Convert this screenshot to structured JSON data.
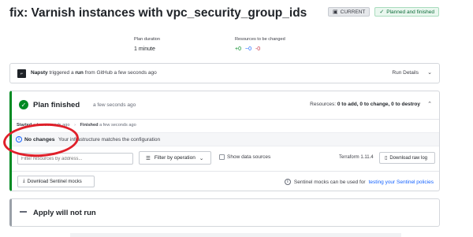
{
  "header": {
    "title": "fix: Varnish instances with vpc_security_group_ids",
    "badge_current": "CURRENT",
    "badge_status": "Planned and finished"
  },
  "meta": {
    "duration_label": "Plan duration",
    "duration_value": "1 minute",
    "resources_label": "Resources to be changed",
    "add": "+0",
    "change": "~0",
    "destroy": "-0"
  },
  "run": {
    "user": "Napsty",
    "triggered_text": "triggered a",
    "run_word": "run",
    "from_text": "from GitHub a few seconds ago",
    "details_label": "Run Details"
  },
  "plan": {
    "title": "Plan finished",
    "time": "a few seconds ago",
    "summary_prefix": "Resources:",
    "summary_add": "0 to add,",
    "summary_change": "0 to change,",
    "summary_destroy": "0 to destroy",
    "started_label": "Started",
    "started_time": "a few seconds ago",
    "finished_label": "Finished",
    "finished_time": "a few seconds ago",
    "no_changes_title": "No changes",
    "no_changes_msg": "Your infrastructure matches the configuration",
    "filter_placeholder": "Filter resources by address...",
    "filter_op_label": "Filter by operation",
    "show_ds_label": "Show data sources",
    "tf_version": "Terraform 1.11.4",
    "raw_log_label": "Download raw log",
    "sentinel_btn_label": "Download Sentinel mocks",
    "sentinel_note": "Sentinel mocks can be used for",
    "sentinel_link": "testing your Sentinel policies"
  },
  "apply": {
    "title": "Apply will not run"
  },
  "colors": {
    "success": "#008a22",
    "link": "#1563ff",
    "danger": "#c73445",
    "annotation": "#e0202a"
  }
}
